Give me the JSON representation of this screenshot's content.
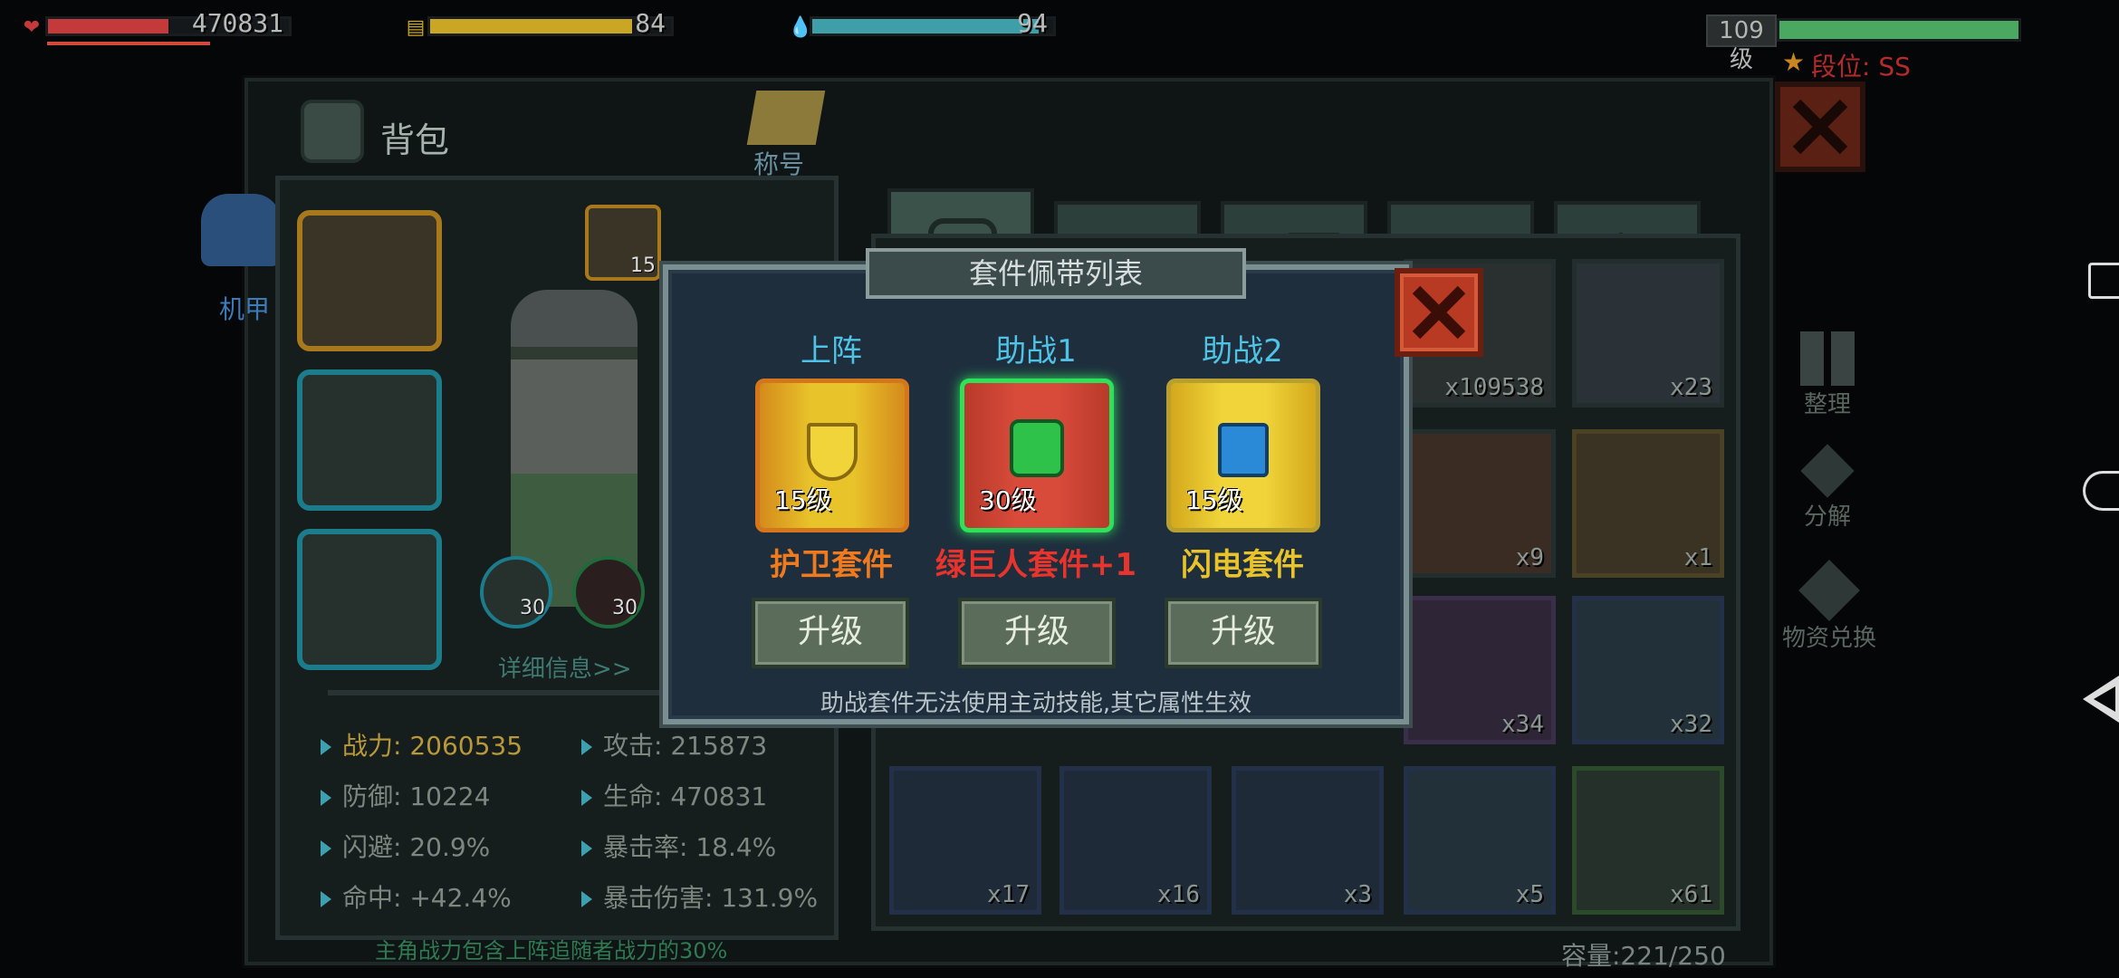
{
  "hud": {
    "hp": {
      "value": "470831",
      "fill": 0.5,
      "color": "#c43a3a"
    },
    "energy": {
      "value": "84",
      "fill": 0.84,
      "color": "#c9a624"
    },
    "water": {
      "value": "94",
      "fill": 0.94,
      "color": "#3f9fa8"
    },
    "level": {
      "label": "109级",
      "fill": 1.0,
      "color": "#4aa860"
    },
    "rank": "段位: SS"
  },
  "inventory": {
    "title": "背包",
    "title_badge": "称号",
    "mech_label": "机甲",
    "gear_levels": [
      "15",
      "30",
      "30"
    ],
    "detail_link": "详细信息>>",
    "stats": [
      "战力: 2060535",
      "攻击: 215873",
      "防御: 10224",
      "生命: 470831",
      "闪避: 20.9%",
      "暴击率: 18.4%",
      "命中: +42.4%",
      "暴击伤害: 131.9%"
    ],
    "footnote": "主角战力包含上阵追随者战力的30%"
  },
  "tabs": [
    {
      "icon": "backpack-icon",
      "active": true
    },
    {
      "icon": "medkit-icon",
      "active": false
    },
    {
      "icon": "ammo-belt-icon",
      "active": false
    },
    {
      "icon": "pistol-icon",
      "active": false
    },
    {
      "icon": "wrench-icon",
      "active": false
    }
  ],
  "grid": {
    "quantities": [
      "x109538",
      "x23",
      "x9",
      "x1",
      "x34",
      "x32",
      "x17",
      "x16",
      "x3",
      "x5",
      "x61"
    ],
    "capacity": "容量:221/250"
  },
  "side_actions": [
    "整理",
    "分解",
    "物资兑换"
  ],
  "modal": {
    "title": "套件佩带列表",
    "slots": [
      {
        "header": "上阵",
        "level": "15级",
        "name": "护卫套件",
        "name_color": "#f07a1e",
        "button": "升级",
        "icon": "shield-kit-icon"
      },
      {
        "header": "助战1",
        "level": "30级",
        "name": "绿巨人套件+1",
        "name_color": "#e8342c",
        "button": "升级",
        "icon": "fist-kit-icon"
      },
      {
        "header": "助战2",
        "level": "15级",
        "name": "闪电套件",
        "name_color": "#e8c32a",
        "button": "升级",
        "icon": "lightning-kit-icon"
      }
    ],
    "note": "助战套件无法使用主动技能,其它属性生效"
  }
}
